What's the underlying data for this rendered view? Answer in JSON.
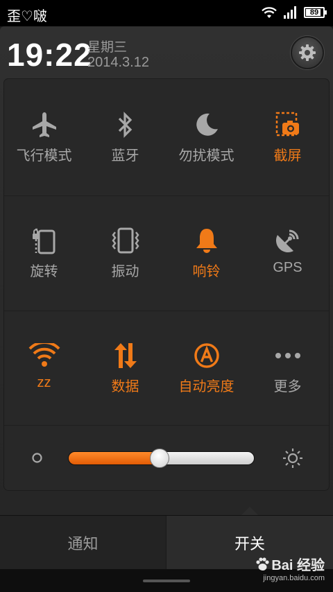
{
  "status_bar": {
    "carrier": "歪♡啵",
    "battery": "89",
    "icons": [
      "wifi-icon",
      "signal-icon",
      "battery-icon"
    ]
  },
  "header": {
    "time": "19:22",
    "weekday": "星期三",
    "date": "2014.3.12",
    "settings_icon": "gear-icon"
  },
  "colors": {
    "accent": "#f07a18",
    "inactive": "#a8a8a8",
    "background": "#282828"
  },
  "toggles": [
    {
      "label": "飞行模式",
      "icon": "airplane-icon",
      "active": false
    },
    {
      "label": "蓝牙",
      "icon": "bluetooth-icon",
      "active": false
    },
    {
      "label": "勿扰模式",
      "icon": "moon-icon",
      "active": false
    },
    {
      "label": "截屏",
      "icon": "screenshot-icon",
      "active": true
    },
    {
      "label": "旋转",
      "icon": "rotation-lock-icon",
      "active": false
    },
    {
      "label": "振动",
      "icon": "vibrate-icon",
      "active": false
    },
    {
      "label": "响铃",
      "icon": "bell-icon",
      "active": true
    },
    {
      "label": "GPS",
      "icon": "gps-icon",
      "active": false
    },
    {
      "label": "zz",
      "icon": "wifi-icon",
      "active": true
    },
    {
      "label": "数据",
      "icon": "data-arrows-icon",
      "active": true
    },
    {
      "label": "自动亮度",
      "icon": "auto-brightness-icon",
      "active": true
    },
    {
      "label": "更多",
      "icon": "more-icon",
      "active": false
    }
  ],
  "brightness": {
    "level": 0.49,
    "min_icon": "brightness-low-icon",
    "max_icon": "brightness-high-icon"
  },
  "tabs": {
    "notifications": "通知",
    "toggles": "开关"
  },
  "watermark": {
    "logo": "Bai 经验",
    "url": "jingyan.baidu.com"
  }
}
